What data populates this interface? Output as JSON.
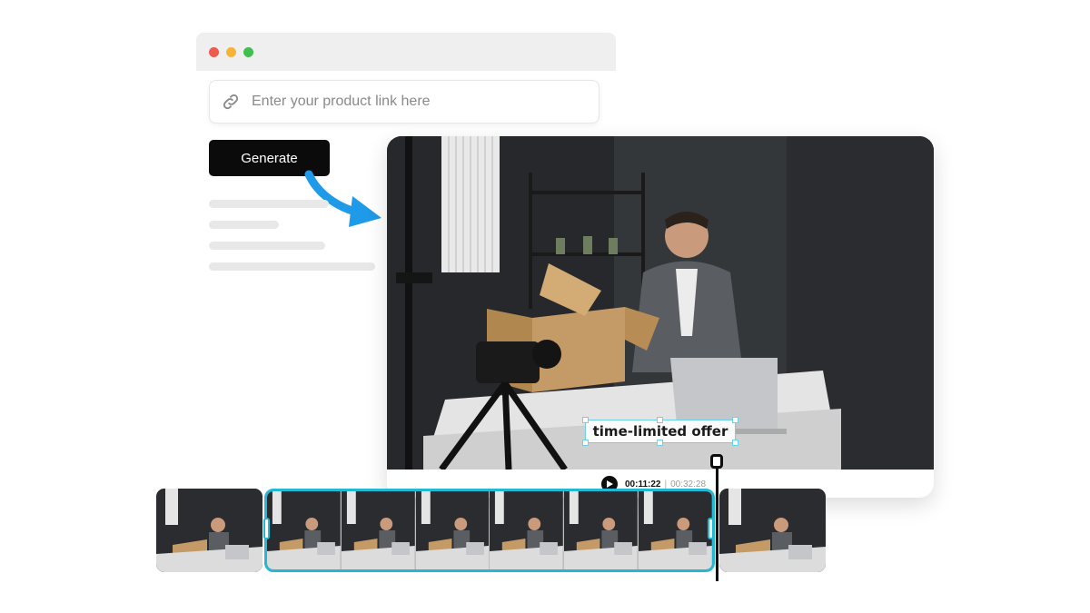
{
  "browser": {
    "dots": [
      {
        "name": "close",
        "color": "#ee5a4e"
      },
      {
        "name": "minimize",
        "color": "#f4b43c"
      },
      {
        "name": "maximize",
        "color": "#3fbf4d"
      }
    ]
  },
  "input": {
    "placeholder": "Enter your product link here",
    "value": "",
    "icon": "link-icon"
  },
  "generate": {
    "label": "Generate"
  },
  "video": {
    "caption": "time-limited offer",
    "current_time": "00:11:22",
    "separator": "|",
    "total_time": "00:32:28"
  },
  "colors": {
    "accent": "#23b9d6",
    "arrow": "#1e9ae8",
    "button": "#0b0b0b"
  }
}
